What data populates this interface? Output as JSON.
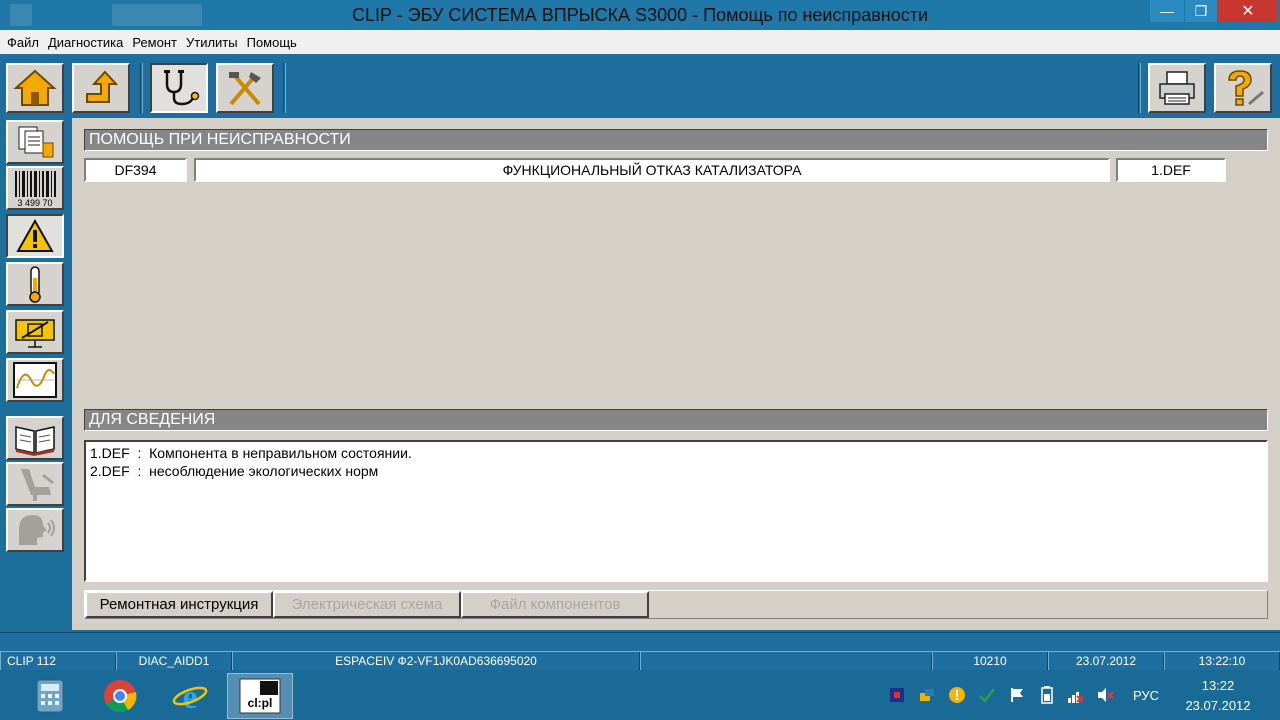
{
  "window": {
    "title": "CLIP - ЭБУ СИСТЕМА ВПРЫСКА S3000 - Помощь по неисправности",
    "minimize": "—",
    "maximize": "❐",
    "close": "✕"
  },
  "menu": [
    "Файл",
    "Диагностика",
    "Ремонт",
    "Утилиты",
    "Помощь"
  ],
  "fault_help": {
    "header": "ПОМОЩЬ ПРИ НЕИСПРАВНОСТИ",
    "code": "DF394",
    "description": "ФУНКЦИОНАЛЬНЫЙ ОТКАЗ КАТАЛИЗАТОРА",
    "status": "1.DEF"
  },
  "info": {
    "header": "ДЛЯ СВЕДЕНИЯ",
    "lines": [
      "1.DEF  :  Компонента в неправильном состоянии.",
      "2.DEF  :  несоблюдение экологических норм"
    ]
  },
  "tabs": [
    {
      "label": "Ремонтная инструкция",
      "state": "active"
    },
    {
      "label": "Электрическая схема",
      "state": "disabled"
    },
    {
      "label": "Файл компонентов",
      "state": "disabled"
    }
  ],
  "status": {
    "program": "CLIP 112",
    "module": "DIAC_AIDD1",
    "vehicle": "ESPACEIV Ф2-VF1JK0AD636695020",
    "code": "10210",
    "date": "23.07.2012",
    "time": "13:22:10"
  },
  "icons": {
    "barcode_digits": "3 499 70",
    "taskbar_app_label": "cl:pl"
  },
  "taskbar": {
    "language": "РУС",
    "clock_time": "13:22",
    "clock_date": "23.07.2012"
  },
  "colors": {
    "window_bg": "#1d6f9c",
    "panel_bg": "#d4d0c8",
    "section_header": "#868686",
    "close_red": "#c7372f",
    "warning_yellow": "#f5c400"
  }
}
